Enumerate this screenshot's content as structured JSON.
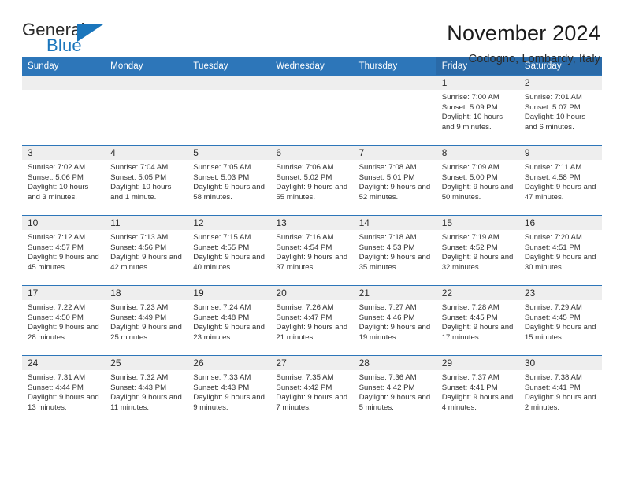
{
  "logo": {
    "word_top": "General",
    "word_bottom": "Blue",
    "triangle_icon": "blue-triangle-icon",
    "accent_color": "#1b76bc"
  },
  "header": {
    "title": "November 2024",
    "subtitle": "Codogno, Lombardy, Italy"
  },
  "theme": {
    "header_blue": "#2d76b9",
    "header_weekend_blue": "#2a6aa8",
    "daynum_strip": "#eeeeee",
    "text": "#333333"
  },
  "calendar": {
    "weekday_headers": [
      {
        "label": "Sunday",
        "weekend": false
      },
      {
        "label": "Monday",
        "weekend": false
      },
      {
        "label": "Tuesday",
        "weekend": false
      },
      {
        "label": "Wednesday",
        "weekend": false
      },
      {
        "label": "Thursday",
        "weekend": false
      },
      {
        "label": "Friday",
        "weekend": true
      },
      {
        "label": "Saturday",
        "weekend": true
      }
    ],
    "labels": {
      "sunrise_prefix": "Sunrise: ",
      "sunset_prefix": "Sunset: ",
      "daylight_prefix": "Daylight: "
    },
    "weeks": [
      [
        {
          "day": "",
          "empty": true
        },
        {
          "day": "",
          "empty": true
        },
        {
          "day": "",
          "empty": true
        },
        {
          "day": "",
          "empty": true
        },
        {
          "day": "",
          "empty": true
        },
        {
          "day": "1",
          "sunrise": "Sunrise: 7:00 AM",
          "sunset": "Sunset: 5:09 PM",
          "daylight": "Daylight: 10 hours and 9 minutes."
        },
        {
          "day": "2",
          "sunrise": "Sunrise: 7:01 AM",
          "sunset": "Sunset: 5:07 PM",
          "daylight": "Daylight: 10 hours and 6 minutes."
        }
      ],
      [
        {
          "day": "3",
          "sunrise": "Sunrise: 7:02 AM",
          "sunset": "Sunset: 5:06 PM",
          "daylight": "Daylight: 10 hours and 3 minutes."
        },
        {
          "day": "4",
          "sunrise": "Sunrise: 7:04 AM",
          "sunset": "Sunset: 5:05 PM",
          "daylight": "Daylight: 10 hours and 1 minute."
        },
        {
          "day": "5",
          "sunrise": "Sunrise: 7:05 AM",
          "sunset": "Sunset: 5:03 PM",
          "daylight": "Daylight: 9 hours and 58 minutes."
        },
        {
          "day": "6",
          "sunrise": "Sunrise: 7:06 AM",
          "sunset": "Sunset: 5:02 PM",
          "daylight": "Daylight: 9 hours and 55 minutes."
        },
        {
          "day": "7",
          "sunrise": "Sunrise: 7:08 AM",
          "sunset": "Sunset: 5:01 PM",
          "daylight": "Daylight: 9 hours and 52 minutes."
        },
        {
          "day": "8",
          "sunrise": "Sunrise: 7:09 AM",
          "sunset": "Sunset: 5:00 PM",
          "daylight": "Daylight: 9 hours and 50 minutes."
        },
        {
          "day": "9",
          "sunrise": "Sunrise: 7:11 AM",
          "sunset": "Sunset: 4:58 PM",
          "daylight": "Daylight: 9 hours and 47 minutes."
        }
      ],
      [
        {
          "day": "10",
          "sunrise": "Sunrise: 7:12 AM",
          "sunset": "Sunset: 4:57 PM",
          "daylight": "Daylight: 9 hours and 45 minutes."
        },
        {
          "day": "11",
          "sunrise": "Sunrise: 7:13 AM",
          "sunset": "Sunset: 4:56 PM",
          "daylight": "Daylight: 9 hours and 42 minutes."
        },
        {
          "day": "12",
          "sunrise": "Sunrise: 7:15 AM",
          "sunset": "Sunset: 4:55 PM",
          "daylight": "Daylight: 9 hours and 40 minutes."
        },
        {
          "day": "13",
          "sunrise": "Sunrise: 7:16 AM",
          "sunset": "Sunset: 4:54 PM",
          "daylight": "Daylight: 9 hours and 37 minutes."
        },
        {
          "day": "14",
          "sunrise": "Sunrise: 7:18 AM",
          "sunset": "Sunset: 4:53 PM",
          "daylight": "Daylight: 9 hours and 35 minutes."
        },
        {
          "day": "15",
          "sunrise": "Sunrise: 7:19 AM",
          "sunset": "Sunset: 4:52 PM",
          "daylight": "Daylight: 9 hours and 32 minutes."
        },
        {
          "day": "16",
          "sunrise": "Sunrise: 7:20 AM",
          "sunset": "Sunset: 4:51 PM",
          "daylight": "Daylight: 9 hours and 30 minutes."
        }
      ],
      [
        {
          "day": "17",
          "sunrise": "Sunrise: 7:22 AM",
          "sunset": "Sunset: 4:50 PM",
          "daylight": "Daylight: 9 hours and 28 minutes."
        },
        {
          "day": "18",
          "sunrise": "Sunrise: 7:23 AM",
          "sunset": "Sunset: 4:49 PM",
          "daylight": "Daylight: 9 hours and 25 minutes."
        },
        {
          "day": "19",
          "sunrise": "Sunrise: 7:24 AM",
          "sunset": "Sunset: 4:48 PM",
          "daylight": "Daylight: 9 hours and 23 minutes."
        },
        {
          "day": "20",
          "sunrise": "Sunrise: 7:26 AM",
          "sunset": "Sunset: 4:47 PM",
          "daylight": "Daylight: 9 hours and 21 minutes."
        },
        {
          "day": "21",
          "sunrise": "Sunrise: 7:27 AM",
          "sunset": "Sunset: 4:46 PM",
          "daylight": "Daylight: 9 hours and 19 minutes."
        },
        {
          "day": "22",
          "sunrise": "Sunrise: 7:28 AM",
          "sunset": "Sunset: 4:45 PM",
          "daylight": "Daylight: 9 hours and 17 minutes."
        },
        {
          "day": "23",
          "sunrise": "Sunrise: 7:29 AM",
          "sunset": "Sunset: 4:45 PM",
          "daylight": "Daylight: 9 hours and 15 minutes."
        }
      ],
      [
        {
          "day": "24",
          "sunrise": "Sunrise: 7:31 AM",
          "sunset": "Sunset: 4:44 PM",
          "daylight": "Daylight: 9 hours and 13 minutes."
        },
        {
          "day": "25",
          "sunrise": "Sunrise: 7:32 AM",
          "sunset": "Sunset: 4:43 PM",
          "daylight": "Daylight: 9 hours and 11 minutes."
        },
        {
          "day": "26",
          "sunrise": "Sunrise: 7:33 AM",
          "sunset": "Sunset: 4:43 PM",
          "daylight": "Daylight: 9 hours and 9 minutes."
        },
        {
          "day": "27",
          "sunrise": "Sunrise: 7:35 AM",
          "sunset": "Sunset: 4:42 PM",
          "daylight": "Daylight: 9 hours and 7 minutes."
        },
        {
          "day": "28",
          "sunrise": "Sunrise: 7:36 AM",
          "sunset": "Sunset: 4:42 PM",
          "daylight": "Daylight: 9 hours and 5 minutes."
        },
        {
          "day": "29",
          "sunrise": "Sunrise: 7:37 AM",
          "sunset": "Sunset: 4:41 PM",
          "daylight": "Daylight: 9 hours and 4 minutes."
        },
        {
          "day": "30",
          "sunrise": "Sunrise: 7:38 AM",
          "sunset": "Sunset: 4:41 PM",
          "daylight": "Daylight: 9 hours and 2 minutes."
        }
      ]
    ]
  }
}
